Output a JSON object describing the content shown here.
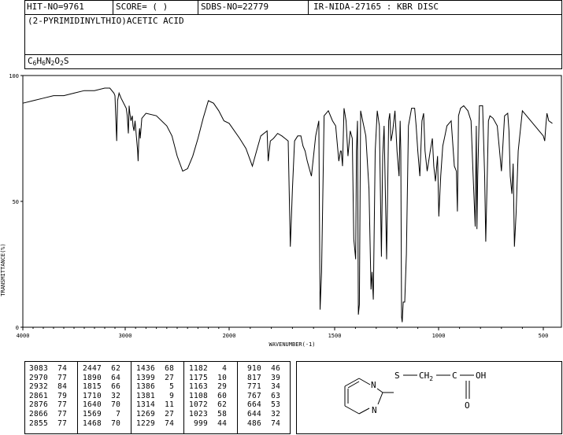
{
  "header": {
    "hit_no": "HIT-NO=9761",
    "score": "SCORE=  (   )",
    "sdbs_no": "SDBS-NO=22779",
    "ir_info": "IR-NIDA-27165 : KBR DISC",
    "compound_name": "(2-PYRIMIDINYLTHIO)ACETIC ACID",
    "formula_parts": [
      {
        "t": "C",
        "sub": false
      },
      {
        "t": "6",
        "sub": true
      },
      {
        "t": "H",
        "sub": false
      },
      {
        "t": "6",
        "sub": true
      },
      {
        "t": "N",
        "sub": false
      },
      {
        "t": "2",
        "sub": true
      },
      {
        "t": "O",
        "sub": false
      },
      {
        "t": "2",
        "sub": true
      },
      {
        "t": "S",
        "sub": false
      }
    ]
  },
  "chart_data": {
    "type": "line",
    "title": "",
    "xlabel": "WAVENUMBER(-1)",
    "ylabel": "TRANSMITTANCE(%)",
    "xlim": [
      4000,
      400
    ],
    "ylim": [
      0,
      100
    ],
    "x_ticks": [
      4000,
      3000,
      2000,
      1500,
      1000,
      500
    ],
    "y_ticks": [
      0,
      50,
      100
    ],
    "grid": false,
    "line_color": "#000000",
    "x": [
      4000,
      3900,
      3800,
      3700,
      3600,
      3500,
      3400,
      3300,
      3200,
      3150,
      3110,
      3100,
      3083,
      3075,
      3060,
      3040,
      2990,
      2980,
      2970,
      2962,
      2955,
      2945,
      2932,
      2925,
      2915,
      2905,
      2880,
      2876,
      2870,
      2866,
      2861,
      2855,
      2840,
      2800,
      2700,
      2600,
      2550,
      2500,
      2447,
      2400,
      2350,
      2300,
      2250,
      2200,
      2150,
      2100,
      2050,
      2000,
      1950,
      1920,
      1890,
      1870,
      1850,
      1820,
      1815,
      1805,
      1790,
      1770,
      1750,
      1735,
      1720,
      1710,
      1700,
      1690,
      1675,
      1660,
      1650,
      1640,
      1630,
      1610,
      1590,
      1575,
      1569,
      1562,
      1550,
      1530,
      1510,
      1495,
      1480,
      1472,
      1468,
      1462,
      1455,
      1445,
      1436,
      1425,
      1415,
      1408,
      1399,
      1395,
      1390,
      1386,
      1381,
      1375,
      1365,
      1350,
      1335,
      1325,
      1320,
      1314,
      1305,
      1295,
      1285,
      1275,
      1269,
      1262,
      1250,
      1240,
      1235,
      1229,
      1222,
      1210,
      1200,
      1190,
      1185,
      1182,
      1178,
      1175,
      1170,
      1163,
      1155,
      1145,
      1130,
      1115,
      1108,
      1100,
      1090,
      1080,
      1072,
      1065,
      1055,
      1040,
      1030,
      1023,
      1015,
      1005,
      999,
      990,
      980,
      970,
      960,
      940,
      925,
      915,
      910,
      905,
      895,
      880,
      860,
      845,
      835,
      825,
      820,
      817,
      813,
      805,
      790,
      780,
      775,
      771,
      767,
      762,
      755,
      740,
      720,
      700,
      685,
      670,
      664,
      658,
      650,
      644,
      638,
      630,
      620,
      600,
      560,
      520,
      500,
      492,
      486,
      480,
      470,
      450,
      430,
      400
    ],
    "y": [
      89,
      90,
      91,
      92,
      92,
      93,
      94,
      94,
      95,
      95,
      93,
      92,
      74,
      90,
      93,
      91,
      87,
      84,
      77,
      88,
      85,
      82,
      84,
      80,
      78,
      82,
      70,
      66,
      74,
      77,
      79,
      75,
      83,
      85,
      84,
      80,
      76,
      68,
      62,
      63,
      68,
      75,
      83,
      90,
      89,
      86,
      82,
      81,
      75,
      71,
      64,
      70,
      76,
      78,
      66,
      74,
      75,
      77,
      76,
      75,
      74,
      32,
      55,
      74,
      76,
      76,
      72,
      70,
      66,
      60,
      76,
      82,
      7,
      22,
      84,
      86,
      82,
      80,
      66,
      70,
      70,
      64,
      87,
      82,
      68,
      78,
      75,
      35,
      27,
      70,
      82,
      5,
      9,
      86,
      82,
      76,
      55,
      15,
      22,
      11,
      70,
      86,
      80,
      28,
      68,
      80,
      27,
      82,
      85,
      74,
      77,
      86,
      70,
      60,
      82,
      70,
      4,
      2,
      10,
      10,
      29,
      80,
      87,
      87,
      80,
      70,
      60,
      82,
      85,
      70,
      62,
      70,
      75,
      64,
      58,
      68,
      44,
      60,
      72,
      76,
      80,
      82,
      64,
      62,
      46,
      84,
      87,
      88,
      86,
      82,
      60,
      40,
      80,
      39,
      60,
      88,
      88,
      60,
      34,
      48,
      63,
      82,
      84,
      83,
      80,
      62,
      84,
      85,
      78,
      60,
      53,
      65,
      32,
      45,
      70,
      86,
      82,
      78,
      76,
      74,
      80,
      85,
      82,
      81
    ],
    "peak_table_columns": [
      "wavenumber",
      "transmittance"
    ],
    "peak_table": [
      [
        [
          3083,
          74
        ],
        [
          2970,
          77
        ],
        [
          2932,
          84
        ],
        [
          2861,
          79
        ],
        [
          2876,
          77
        ],
        [
          2866,
          77
        ],
        [
          2855,
          77
        ]
      ],
      [
        [
          2447,
          62
        ],
        [
          1890,
          64
        ],
        [
          1815,
          66
        ],
        [
          1710,
          32
        ],
        [
          1640,
          70
        ],
        [
          1569,
          7
        ],
        [
          1468,
          70
        ]
      ],
      [
        [
          1436,
          68
        ],
        [
          1399,
          27
        ],
        [
          1386,
          5
        ],
        [
          1381,
          9
        ],
        [
          1314,
          11
        ],
        [
          1269,
          27
        ],
        [
          1229,
          74
        ]
      ],
      [
        [
          1182,
          4
        ],
        [
          1175,
          10
        ],
        [
          1163,
          29
        ],
        [
          1108,
          60
        ],
        [
          1072,
          62
        ],
        [
          1023,
          58
        ],
        [
          999,
          44
        ]
      ],
      [
        [
          910,
          46
        ],
        [
          817,
          39
        ],
        [
          771,
          34
        ],
        [
          767,
          63
        ],
        [
          664,
          53
        ],
        [
          644,
          32
        ],
        [
          486,
          74
        ]
      ]
    ]
  },
  "structure": {
    "s_label": "S",
    "ch2_label": "CH",
    "ch2_sub": "2",
    "c_label": "C",
    "oh_label": "OH",
    "o_label": "O",
    "n_top_label": "N",
    "n_bottom_label": "N"
  }
}
